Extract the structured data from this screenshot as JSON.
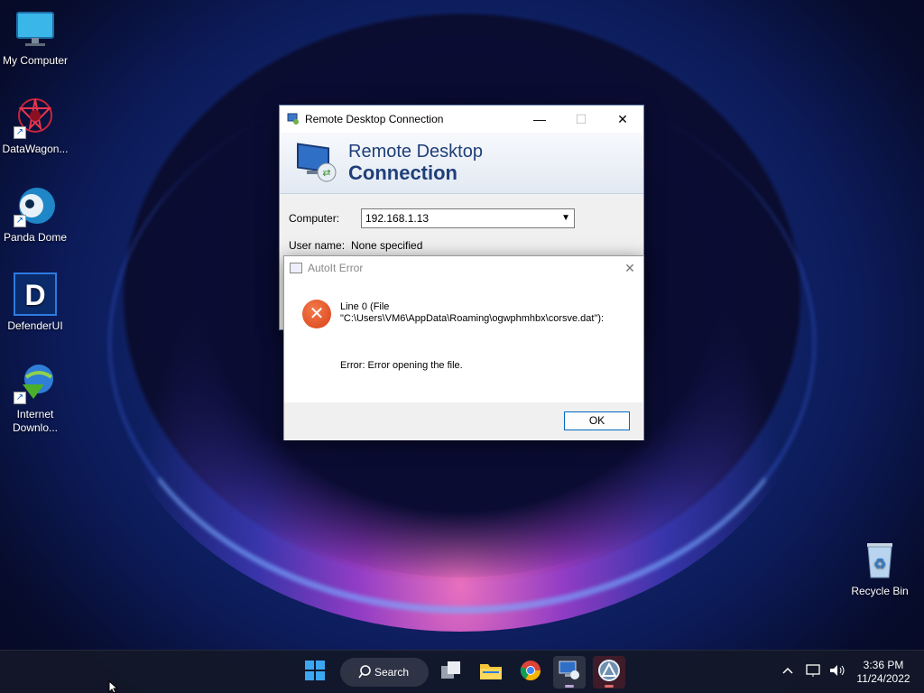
{
  "desktop": {
    "icons": [
      {
        "label": "My Computer"
      },
      {
        "label": "DataWagon..."
      },
      {
        "label": "Panda Dome"
      },
      {
        "label": "DefenderUI"
      },
      {
        "label": "Internet Downlo..."
      },
      {
        "label": "Recycle Bin"
      }
    ]
  },
  "rdc_window": {
    "title": "Remote Desktop Connection",
    "banner_line1": "Remote Desktop",
    "banner_line2": "Connection",
    "computer_label": "Computer:",
    "computer_value": "192.168.1.13",
    "username_label": "User name:",
    "username_value": "None specified"
  },
  "autoit_dialog": {
    "title": "AutoIt Error",
    "line1": "Line 0  (File",
    "line2": "\"C:\\Users\\VM6\\AppData\\Roaming\\ogwphmhbx\\corsve.dat\"):",
    "error": "Error: Error opening the file.",
    "ok_label": "OK"
  },
  "taskbar": {
    "search_label": "Search",
    "time": "3:36 PM",
    "date": "11/24/2022"
  },
  "colors": {
    "accent": "#0067c0",
    "error_icon": "#d9421a",
    "rdc_title": "#1f3f79"
  }
}
